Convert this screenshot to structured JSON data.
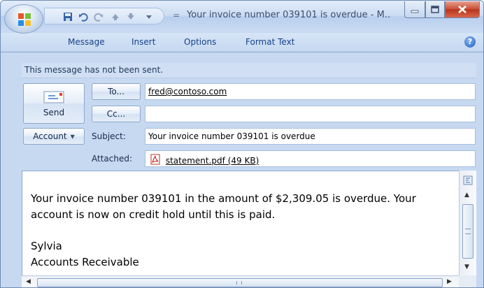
{
  "window": {
    "title": "Your invoice number 039101 is overdue - M..",
    "qat_separator": "="
  },
  "ribbon": {
    "tabs": [
      "Message",
      "Insert",
      "Options",
      "Format Text"
    ],
    "help": "?"
  },
  "infobar": {
    "text": "This message has not been sent."
  },
  "header": {
    "send_label": "Send",
    "to_label": "To...",
    "cc_label": "Cc...",
    "account_label": "Account",
    "subject_label": "Subject:",
    "attached_label": "Attached:",
    "to_value": "fred@contoso.com",
    "cc_value": "",
    "subject_value": "Your invoice number 039101 is overdue",
    "attachment": "statement.pdf (49 KB)"
  },
  "body": {
    "line1": "Your invoice number 039101 in the amount of $2,309.05 is overdue.  Your",
    "line2": "account is now on credit hold until this is paid.",
    "line3": "Sylvia",
    "line4": "Accounts Receivable"
  },
  "scrollbar": {
    "grip_h": "III",
    "grip_v": "≡"
  },
  "colors": {
    "frame": "#c7d9f1",
    "infobar": "#d0dff3",
    "tab_text": "#15428b",
    "close": "#c84b2e"
  }
}
